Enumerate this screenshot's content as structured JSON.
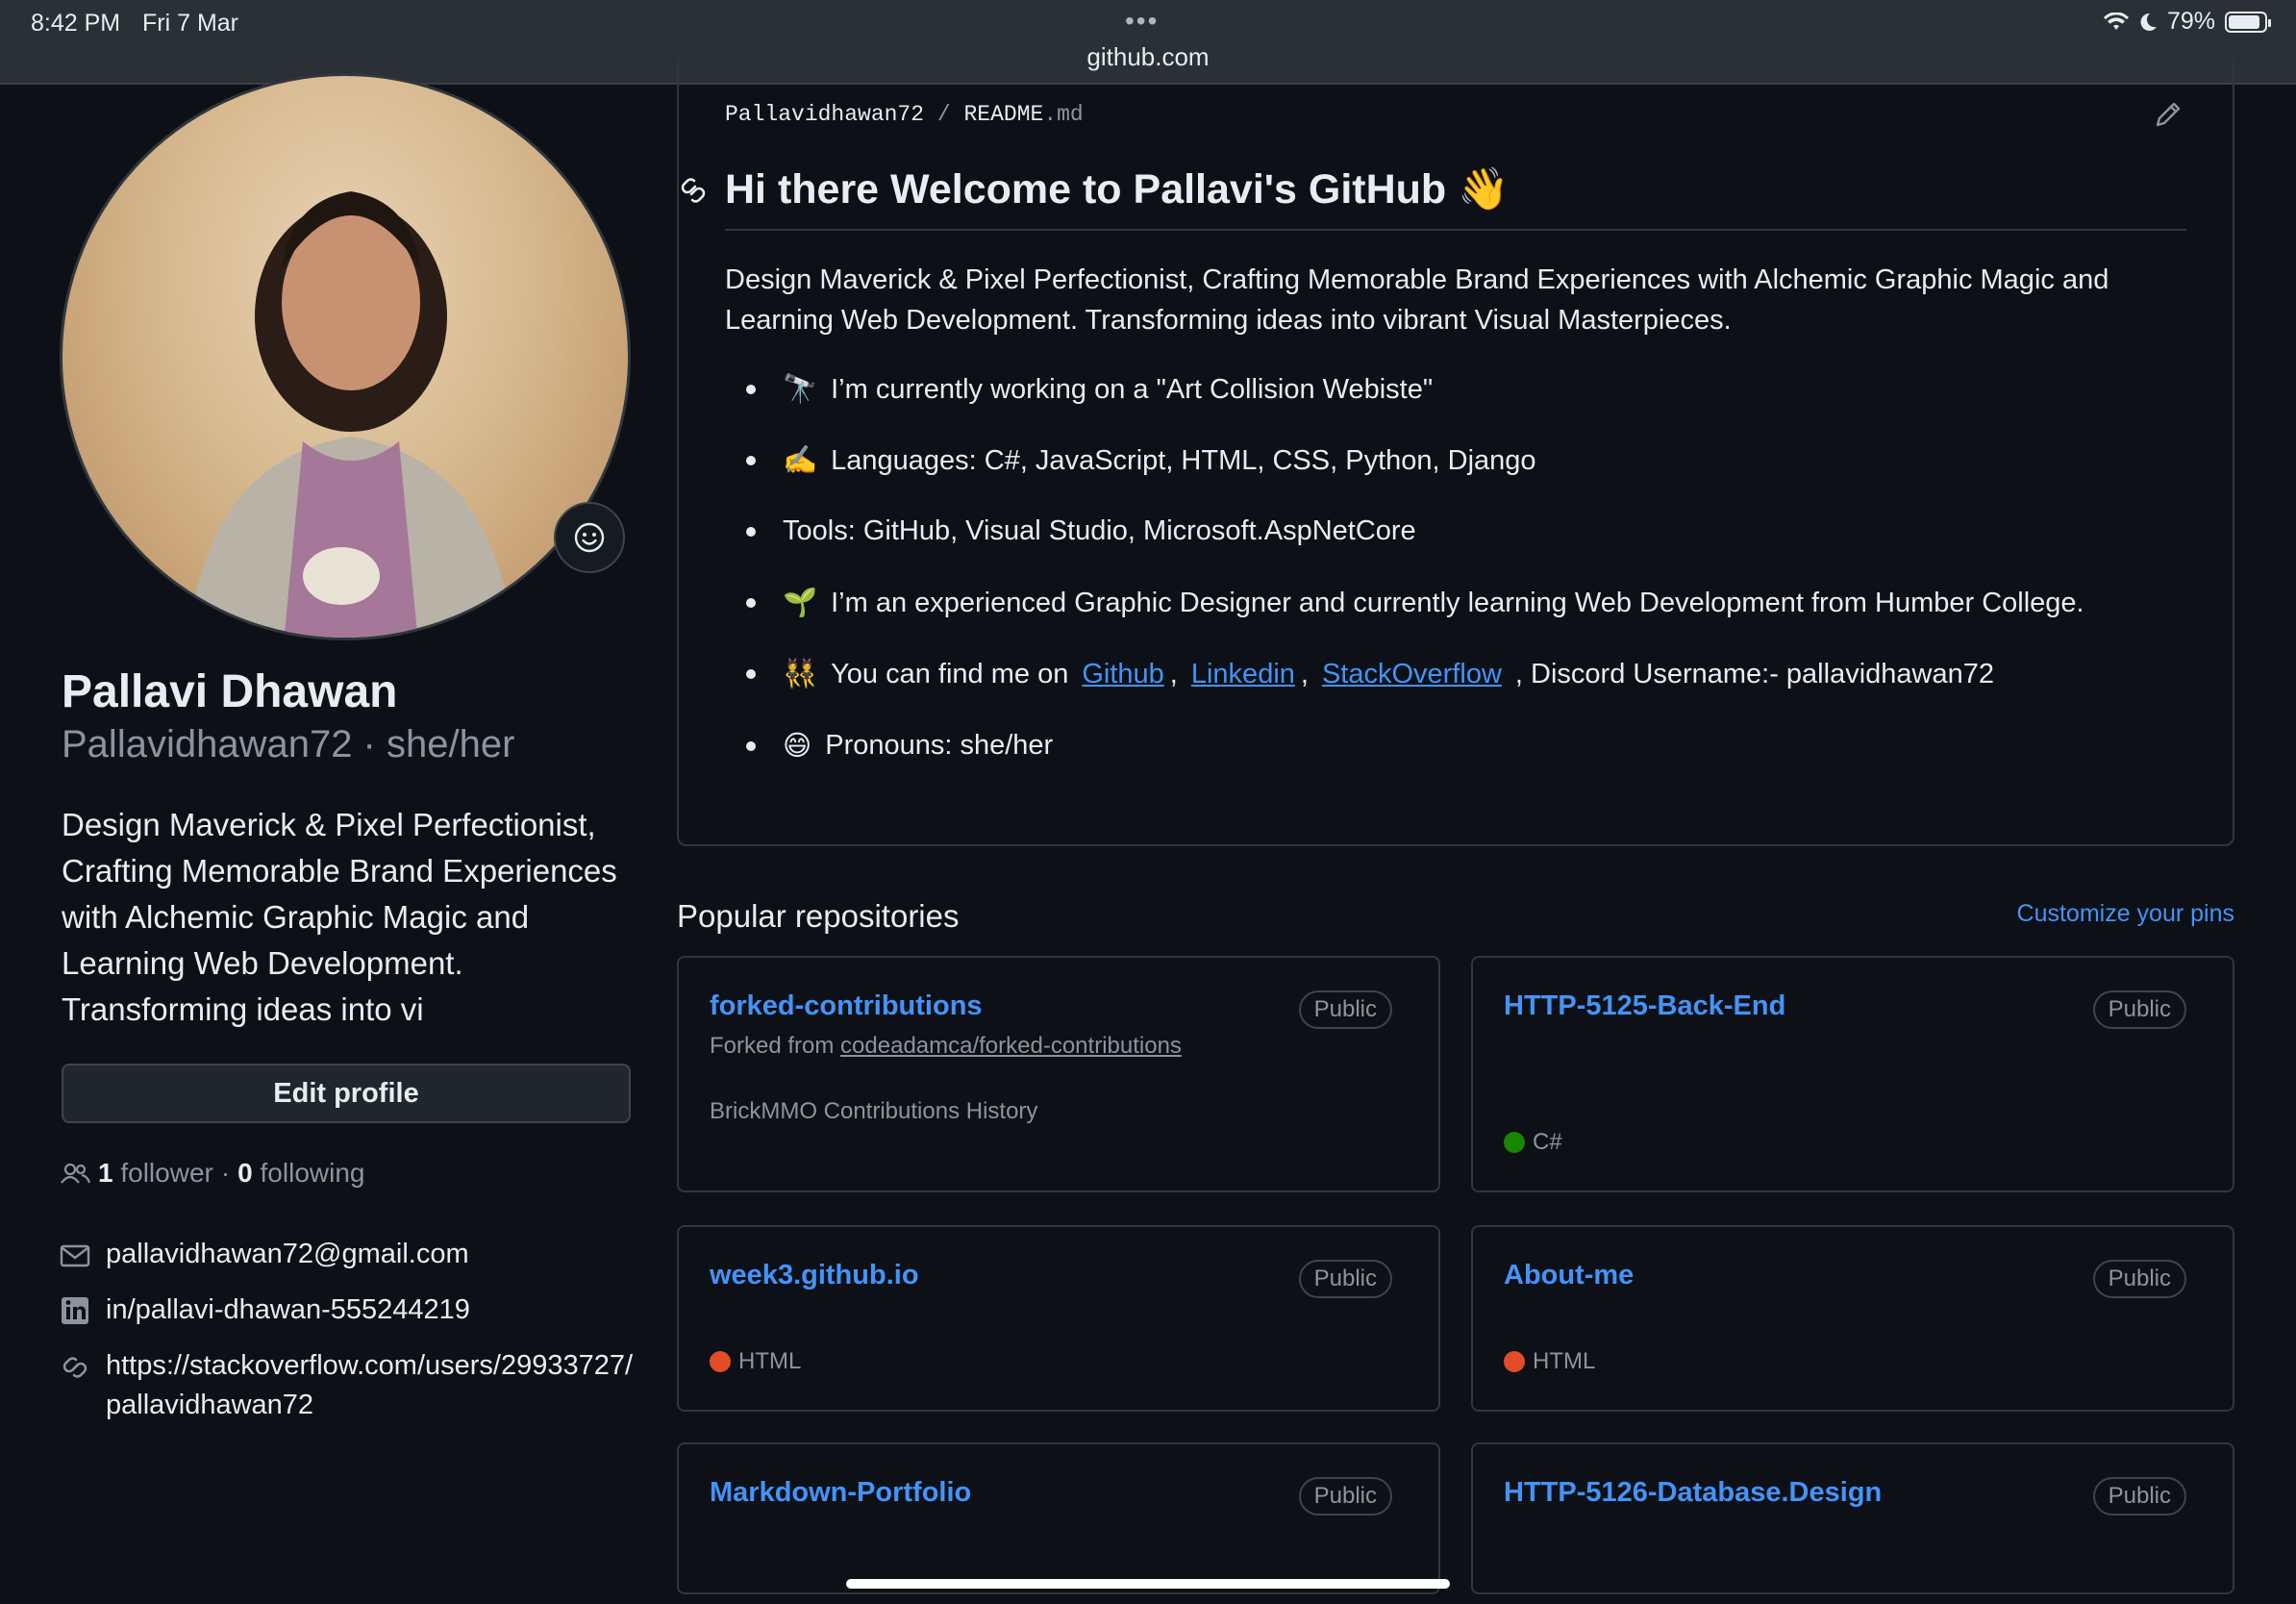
{
  "status_bar": {
    "time": "8:42 PM",
    "date": "Fri 7 Mar",
    "battery": "79%",
    "battery_level": 0.79,
    "url": "github.com"
  },
  "profile": {
    "name": "Pallavi Dhawan",
    "username_pronouns": "Pallavidhawan72 · she/her",
    "bio": "Design Maverick & Pixel Perfectionist, Crafting Memorable Brand Experiences with Alchemic Graphic Magic and Learning Web Development. Transforming ideas into vi",
    "edit_label": "Edit profile",
    "followers_count": "1",
    "followers_label": "follower",
    "separator": "·",
    "following_count": "0",
    "following_label": "following",
    "email": "pallavidhawan72@gmail.com",
    "linkedin": "in/pallavi-dhawan-555244219",
    "website": "https://stackoverflow.com/users/29933727/pallavidhawan72"
  },
  "readme": {
    "path_user": "Pallavidhawan72",
    "path_sep": "/",
    "path_file": "README",
    "path_ext": ".md",
    "title": "Hi there Welcome to Pallavi's GitHub 👋",
    "intro": "Design Maverick & Pixel Perfectionist, Crafting Memorable Brand Experiences with Alchemic Graphic Magic and Learning Web Development. Transforming ideas into vibrant Visual Masterpieces.",
    "bullets": [
      {
        "emoji": "🔭",
        "text": "I’m currently working on a \"Art Collision Webiste\""
      },
      {
        "emoji": "✍️",
        "text": "Languages: C#, JavaScript, HTML, CSS, Python, Django"
      },
      {
        "emoji": "",
        "text": "Tools: GitHub, Visual Studio, Microsoft.AspNetCore"
      },
      {
        "emoji": "🌱",
        "text": "I’m an experienced Graphic Designer and currently learning Web Development from Humber College."
      },
      {
        "emoji": "👯",
        "text_before": "You can find me on",
        "link1": "Github",
        "comma1": ",",
        "link2": "Linkedin",
        "comma2": ",",
        "link3": "StackOverflow",
        "text_after": ", Discord Username:- pallavidhawan72"
      },
      {
        "emoji": "😄",
        "text": "Pronouns: she/her"
      }
    ]
  },
  "popular": {
    "title": "Popular repositories",
    "customize": "Customize your pins",
    "repos": [
      {
        "name": "forked-contributions",
        "visibility": "Public",
        "forked_prefix": "Forked from",
        "forked_from": "codeadamca/forked-contributions",
        "description": "BrickMMO Contributions History"
      },
      {
        "name": "HTTP-5125-Back-End",
        "visibility": "Public",
        "language": "C#",
        "language_color": "#178600"
      },
      {
        "name": "week3.github.io",
        "visibility": "Public",
        "language": "HTML",
        "language_color": "#e34c26"
      },
      {
        "name": "About-me",
        "visibility": "Public",
        "language": "HTML",
        "language_color": "#e34c26"
      },
      {
        "name": "Markdown-Portfolio",
        "visibility": "Public"
      },
      {
        "name": "HTTP-5126-Database.Design",
        "visibility": "Public"
      }
    ]
  },
  "colors": {
    "background": "#0d1117",
    "link": "#4493f8",
    "muted": "#8b949e",
    "border": "#30363d"
  }
}
